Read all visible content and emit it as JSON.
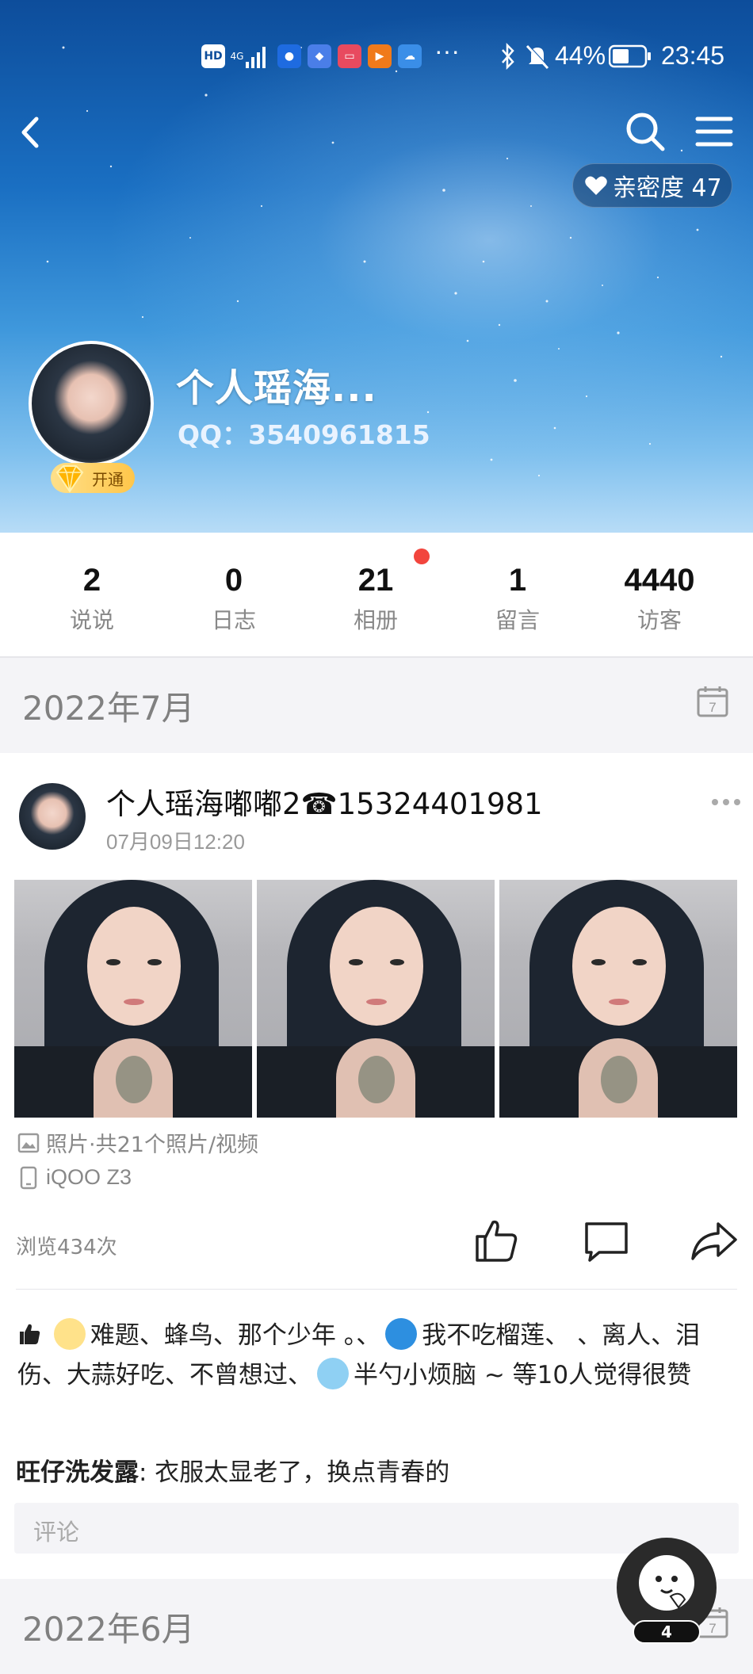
{
  "status_bar": {
    "hd": "HD",
    "network": "4G",
    "battery": "44%",
    "time": "23:45",
    "more": "···"
  },
  "header": {
    "intimacy_label": "亲密度 47"
  },
  "profile": {
    "name": "个人瑶海...",
    "qq": "QQ：3540961815",
    "vip_label": "开通"
  },
  "stats": [
    {
      "num": "2",
      "label": "说说"
    },
    {
      "num": "0",
      "label": "日志"
    },
    {
      "num": "21",
      "label": "相册"
    },
    {
      "num": "1",
      "label": "留言"
    },
    {
      "num": "4440",
      "label": "访客"
    }
  ],
  "months": {
    "first": "2022年7月",
    "second": "2022年6月",
    "calendar_day": "7"
  },
  "post": {
    "author": "个人瑶海嘟嘟2☎15324401981",
    "time": "07月09日12:20",
    "photos_meta": "照片·共21个照片/视频",
    "device": "iQOO Z3",
    "views": "浏览434次",
    "likes_part1": "难题、蜂鸟、那个少年 。、",
    "likes_part2": "我不吃榴莲、  、离人、泪伤、大蒜好吃、不曾想过、",
    "likes_part3": "半勺小烦脑 ~ 等10人觉得很赞",
    "comment_author": "旺仔洗发露",
    "comment_text": ": 衣服太显老了，换点青春的",
    "comment_placeholder": "评论"
  },
  "fab": {
    "count": "4"
  }
}
